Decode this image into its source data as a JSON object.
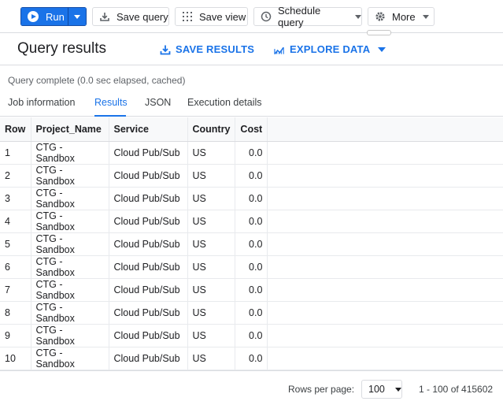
{
  "toolbar": {
    "run_label": "Run",
    "save_query_label": "Save query",
    "save_view_label": "Save view",
    "schedule_query_label": "Schedule query",
    "more_label": "More",
    "icons": [
      "play-icon",
      "save-icon",
      "view-grid-icon",
      "clock-icon",
      "gear-icon"
    ]
  },
  "header": {
    "title": "Query results",
    "save_results_label": "SAVE RESULTS",
    "explore_data_label": "EXPLORE DATA"
  },
  "status": "Query complete (0.0 sec elapsed, cached)",
  "tabs": [
    {
      "label": "Job information",
      "active": false
    },
    {
      "label": "Results",
      "active": true
    },
    {
      "label": "JSON",
      "active": false
    },
    {
      "label": "Execution details",
      "active": false
    }
  ],
  "table": {
    "columns": [
      "Row",
      "Project_Name",
      "Service",
      "Country",
      "Cost"
    ],
    "rows": [
      [
        "1",
        "CTG - Sandbox",
        "Cloud Pub/Sub",
        "US",
        "0.0"
      ],
      [
        "2",
        "CTG - Sandbox",
        "Cloud Pub/Sub",
        "US",
        "0.0"
      ],
      [
        "3",
        "CTG - Sandbox",
        "Cloud Pub/Sub",
        "US",
        "0.0"
      ],
      [
        "4",
        "CTG - Sandbox",
        "Cloud Pub/Sub",
        "US",
        "0.0"
      ],
      [
        "5",
        "CTG - Sandbox",
        "Cloud Pub/Sub",
        "US",
        "0.0"
      ],
      [
        "6",
        "CTG - Sandbox",
        "Cloud Pub/Sub",
        "US",
        "0.0"
      ],
      [
        "7",
        "CTG - Sandbox",
        "Cloud Pub/Sub",
        "US",
        "0.0"
      ],
      [
        "8",
        "CTG - Sandbox",
        "Cloud Pub/Sub",
        "US",
        "0.0"
      ],
      [
        "9",
        "CTG - Sandbox",
        "Cloud Pub/Sub",
        "US",
        "0.0"
      ],
      [
        "10",
        "CTG - Sandbox",
        "Cloud Pub/Sub",
        "US",
        "0.0"
      ]
    ]
  },
  "footer": {
    "rows_per_page_label": "Rows per page:",
    "rows_per_page_value": "100",
    "range_label": "1 - 100 of 415602"
  },
  "colors": {
    "accent": "#1a73e8",
    "border": "#dadce0",
    "text": "#202124",
    "muted": "#5f6368"
  }
}
